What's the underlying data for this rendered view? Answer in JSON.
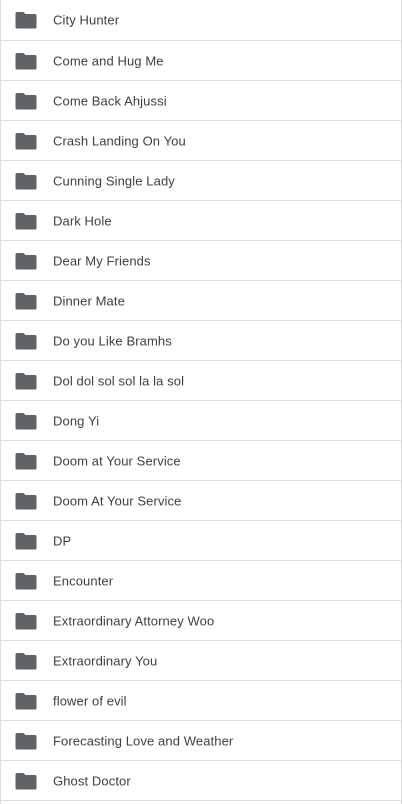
{
  "theme": {
    "folder_icon_color": "#5f6368",
    "text_color": "#3c4043",
    "divider_color": "#dadce0"
  },
  "folders": [
    {
      "name": "City Hunter",
      "icon": "folder-icon"
    },
    {
      "name": "Come and Hug Me",
      "icon": "folder-icon"
    },
    {
      "name": "Come Back Ahjussi",
      "icon": "folder-icon"
    },
    {
      "name": "Crash Landing On You",
      "icon": "folder-icon"
    },
    {
      "name": "Cunning Single Lady",
      "icon": "folder-icon"
    },
    {
      "name": "Dark Hole",
      "icon": "folder-icon"
    },
    {
      "name": "Dear My Friends",
      "icon": "folder-icon"
    },
    {
      "name": "Dinner Mate",
      "icon": "folder-icon"
    },
    {
      "name": "Do you Like Bramhs",
      "icon": "folder-icon"
    },
    {
      "name": "Dol dol sol sol la la sol",
      "icon": "folder-icon"
    },
    {
      "name": "Dong Yi",
      "icon": "folder-icon"
    },
    {
      "name": "Doom at Your Service",
      "icon": "folder-icon"
    },
    {
      "name": "Doom At Your Service",
      "icon": "folder-icon"
    },
    {
      "name": "DP",
      "icon": "folder-icon"
    },
    {
      "name": "Encounter",
      "icon": "folder-icon"
    },
    {
      "name": "Extraordinary Attorney Woo",
      "icon": "folder-icon"
    },
    {
      "name": "Extraordinary You",
      "icon": "folder-icon"
    },
    {
      "name": "flower of evil",
      "icon": "folder-icon"
    },
    {
      "name": "Forecasting Love and Weather",
      "icon": "folder-icon"
    },
    {
      "name": "Ghost Doctor",
      "icon": "folder-icon"
    }
  ]
}
